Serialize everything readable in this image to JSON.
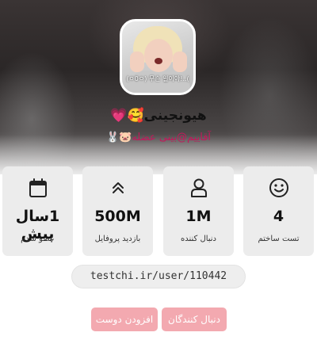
{
  "profile": {
    "avatar_caption": "(ㅇ0ㅇ) 무슨 일이야!..(",
    "name": "هیونجینی🥰💗",
    "handle": "آقاییم@بینی عضله🐷🐰"
  },
  "stats": [
    {
      "value": "4",
      "label": "تست ساختم",
      "icon": "smiley-icon"
    },
    {
      "value": "1M",
      "label": "دنبال کننده",
      "icon": "user-icon"
    },
    {
      "value": "500M",
      "label": "بازدید پروفایل",
      "icon": "double-chevron-up-icon"
    },
    {
      "value": "1سال پیش",
      "label": "عضو شدم",
      "icon": "calendar-icon"
    }
  ],
  "profile_url": "testchi.ir/user/110442",
  "actions": {
    "followers_label": "دنبال کنندگان",
    "add_friend_label": "افزودن دوست"
  },
  "colors": {
    "button_bg": "#f3a9b0",
    "handle_text": "#c2185b",
    "card_bg": "#ececec"
  }
}
